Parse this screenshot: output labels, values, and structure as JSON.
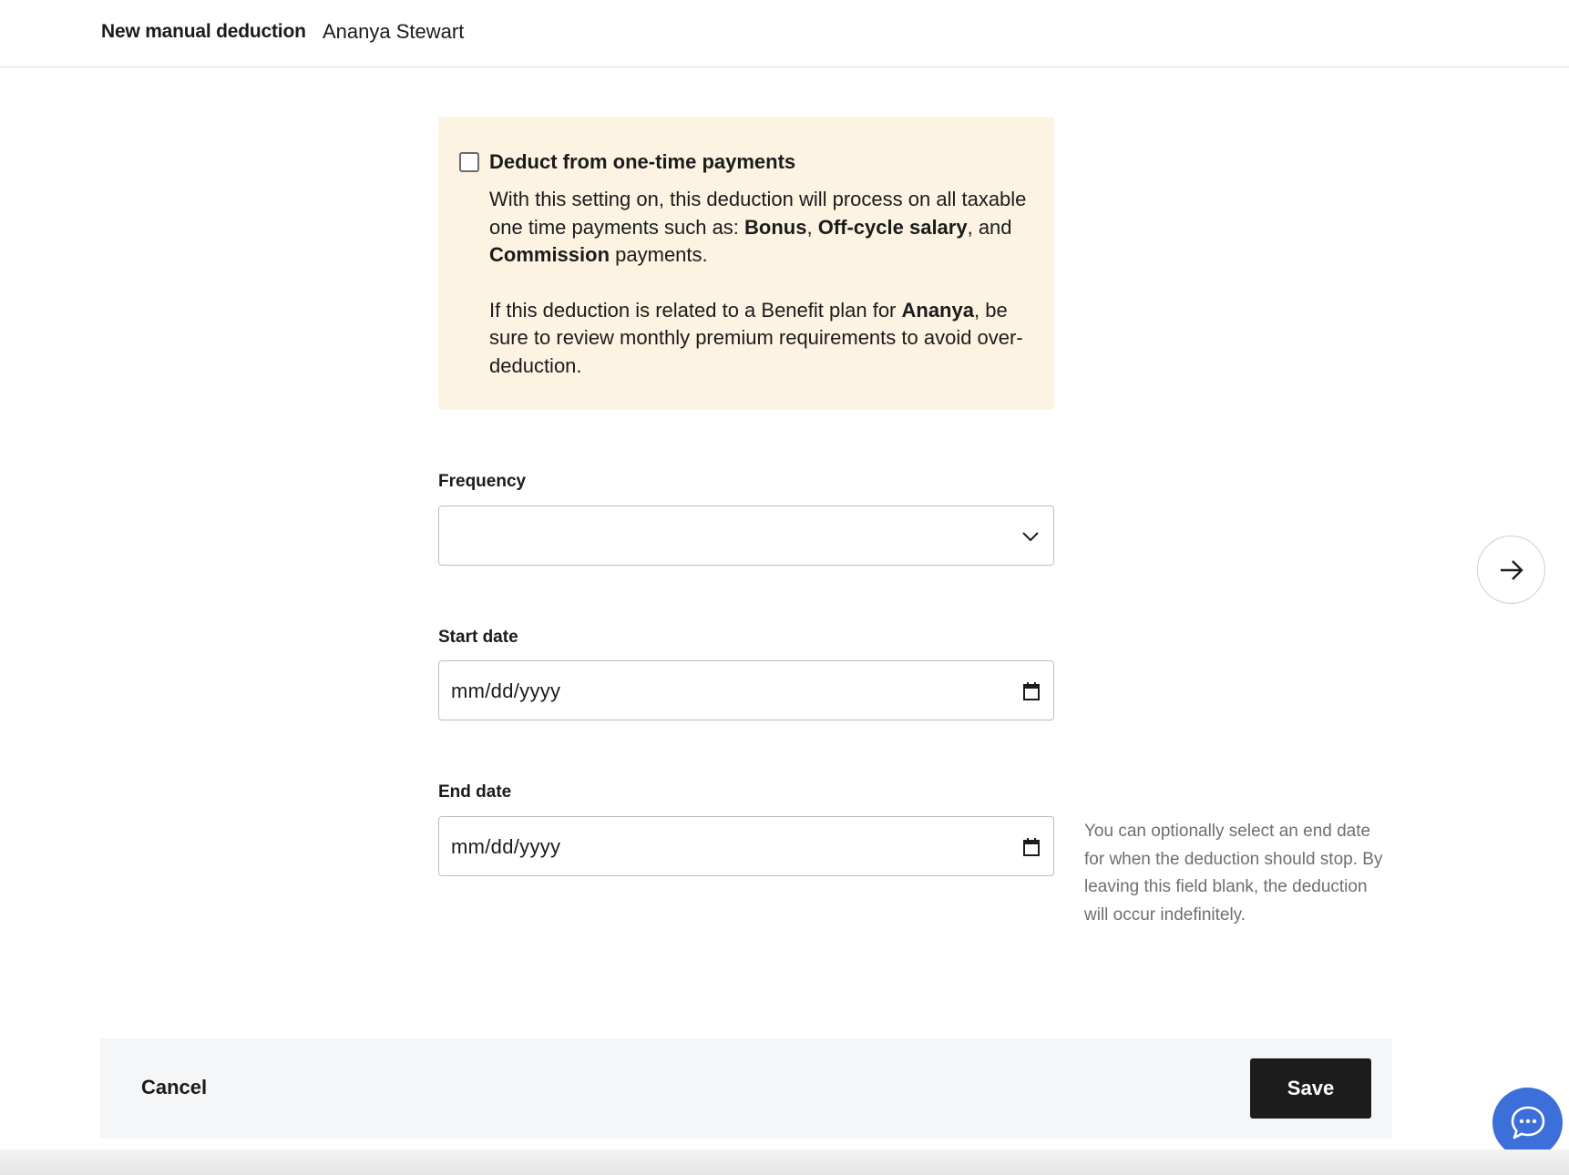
{
  "header": {
    "title": "New manual deduction",
    "subject": "Ananya Stewart"
  },
  "notice": {
    "checkbox_label": "Deduct from one-time payments",
    "checked": false,
    "paragraph1": {
      "t1": "With this setting on, this deduction will process on all taxable one time payments such as: ",
      "b1": "Bonus",
      "t2": ", ",
      "b2": "Off-cycle salary",
      "t3": ", and ",
      "b3": "Commission",
      "t4": " payments."
    },
    "paragraph2": {
      "t1": "If this deduction is related to a Benefit plan for ",
      "b1": "Ananya",
      "t2": ", be sure to review monthly premium requirements to avoid over-deduction."
    },
    "background_color": "#fdf3e2"
  },
  "form": {
    "frequency": {
      "label": "Frequency",
      "value": ""
    },
    "start_date": {
      "label": "Start date",
      "value": "mm/dd/yyyy"
    },
    "end_date": {
      "label": "End date",
      "value": "mm/dd/yyyy",
      "help": "You can optionally select an end date for when the deduction should stop. By leaving this field blank, the deduction will occur indefinitely."
    }
  },
  "footer": {
    "cancel_label": "Cancel",
    "save_label": "Save"
  },
  "icons": {
    "next": "arrow-right-icon",
    "chevron": "chevron-down-icon",
    "calendar": "calendar-icon",
    "chat": "chat-bubble-icon"
  },
  "colors": {
    "primary_button": "#1c1c1c",
    "chat_button": "#3d6fdb",
    "footer_background": "#f5f6f8"
  }
}
